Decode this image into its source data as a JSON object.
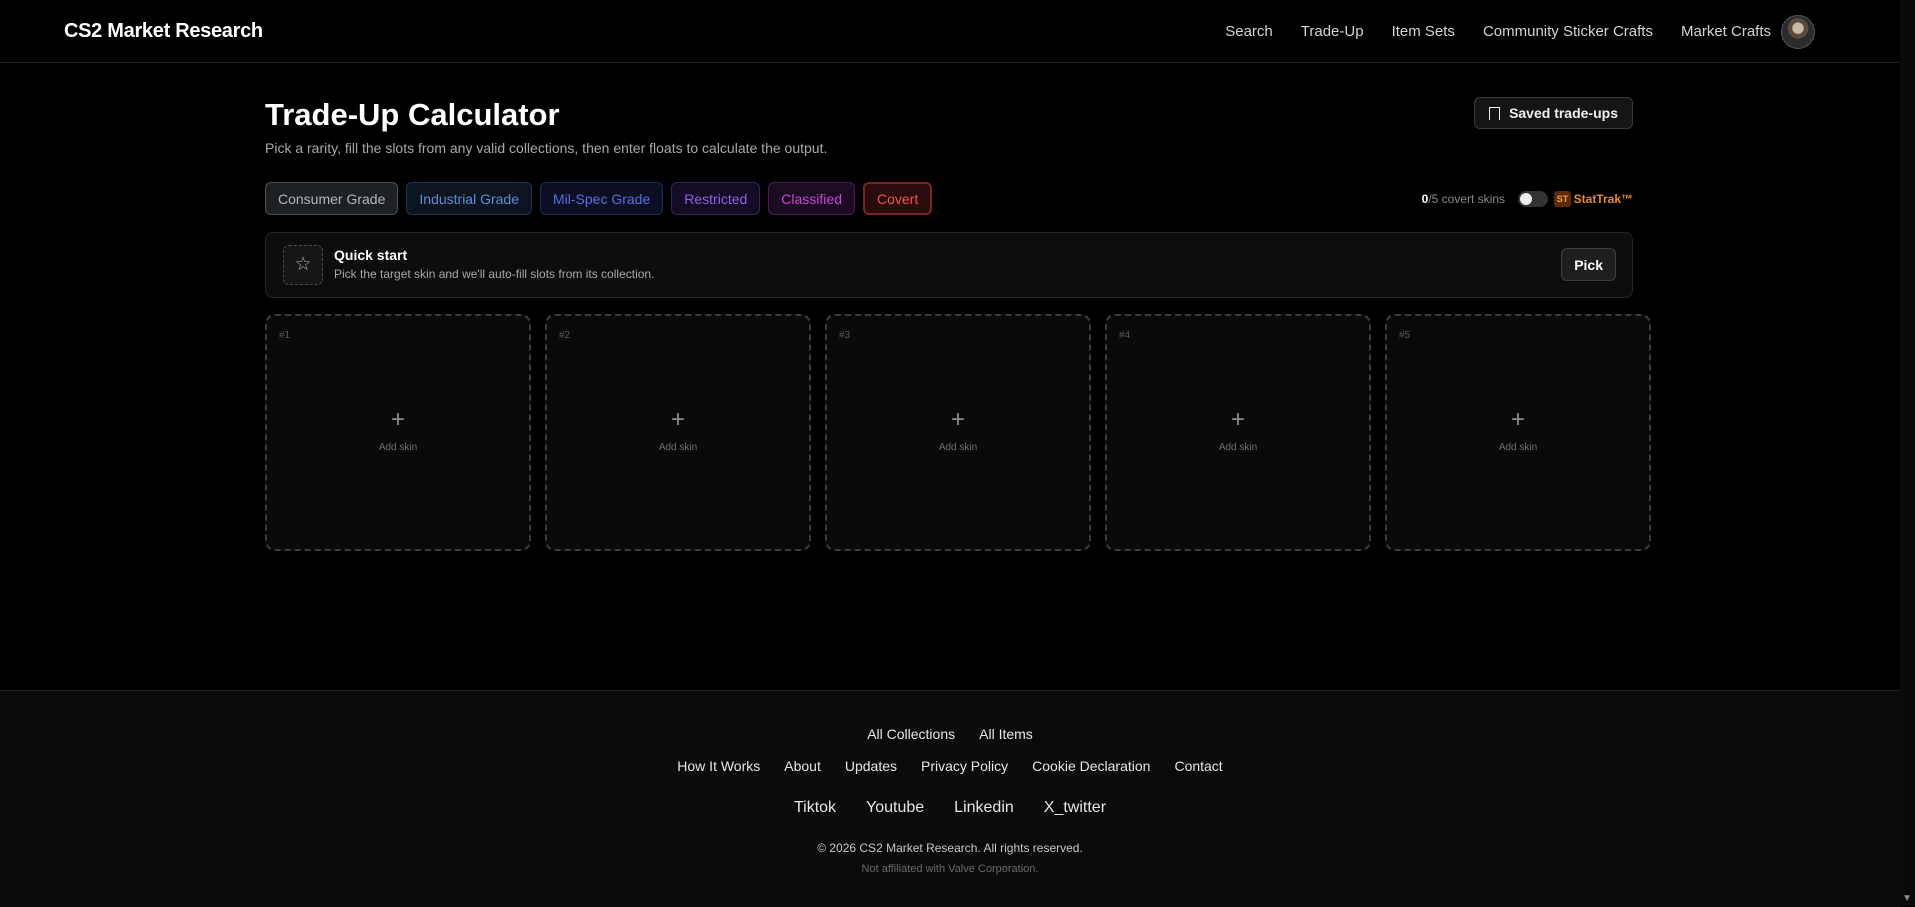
{
  "header": {
    "brand": "CS2 Market Research",
    "nav": [
      "Search",
      "Trade-Up",
      "Item Sets",
      "Community Sticker Crafts",
      "Market Crafts"
    ]
  },
  "page": {
    "title": "Trade-Up Calculator",
    "subtitle": "Pick a rarity, fill the slots from any valid collections, then enter floats to calculate the output.",
    "saved_button": "Saved trade-ups"
  },
  "rarities": [
    "Consumer Grade",
    "Industrial Grade",
    "Mil-Spec Grade",
    "Restricted",
    "Classified",
    "Covert"
  ],
  "selected_rarity": "Covert",
  "counter": {
    "filled": "0",
    "total_text": "/5 covert skins"
  },
  "stattrak": {
    "badge": "ST",
    "label": "StatTrak™",
    "enabled": false
  },
  "quick_start": {
    "title": "Quick start",
    "description": "Pick the target skin and we'll auto-fill slots from its collection.",
    "button": "Pick",
    "icon": "star-icon"
  },
  "slots": [
    {
      "num": "#1",
      "label": "Add skin"
    },
    {
      "num": "#2",
      "label": "Add skin"
    },
    {
      "num": "#3",
      "label": "Add skin"
    },
    {
      "num": "#4",
      "label": "Add skin"
    },
    {
      "num": "#5",
      "label": "Add skin"
    }
  ],
  "footer": {
    "row1": [
      "All Collections",
      "All Items"
    ],
    "row2": [
      "How It Works",
      "About",
      "Updates",
      "Privacy Policy",
      "Cookie Declaration",
      "Contact"
    ],
    "social": [
      "Tiktok",
      "Youtube",
      "Linkedin",
      "X_twitter"
    ],
    "copyright": "© 2026 CS2 Market Research. All rights reserved.",
    "disclaimer": "Not affiliated with Valve Corporation."
  }
}
